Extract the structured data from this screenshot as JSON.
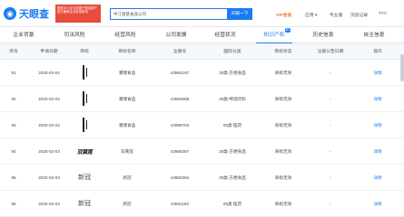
{
  "header": {
    "logo_text": "天眼查",
    "promo_text": "国家中小企业发展子基金旗下 官方备案企业征信机构",
    "search_value": "中汀盘基食品公司",
    "search_button": "天眼一下",
    "nav": {
      "vip": "VIP会员",
      "app": "应用 ▾",
      "pro": "专业版",
      "service": "服务▾",
      "more": "浏览记录",
      "user": "TYC"
    }
  },
  "tabs": [
    {
      "label": "企业背景",
      "count": ""
    },
    {
      "label": "司法风险",
      "count": ""
    },
    {
      "label": "经营风险",
      "count": ""
    },
    {
      "label": "公司发展",
      "count": ""
    },
    {
      "label": "经营状况",
      "count": ""
    },
    {
      "label": "知识产权",
      "count": "81"
    },
    {
      "label": "历史信息",
      "count": ""
    },
    {
      "label": "自主信息",
      "count": ""
    }
  ],
  "table": {
    "headers": [
      "序号",
      "申请日期",
      "商标",
      "商标名称",
      "注册号",
      "国际分类",
      "商标状态",
      "注册公告日期",
      "操作"
    ],
    "rows": [
      {
        "idx": "91",
        "date": "2020-02-04",
        "name": "潘瑞食品",
        "reg": "43994167",
        "cls": "30类-方便食品",
        "status": "商标无效",
        "pub": "-",
        "op": "详情"
      },
      {
        "idx": "92",
        "date": "2020-02-04",
        "name": "潘瑞食品",
        "reg": "43993088",
        "cls": "33类-啤酒饮料",
        "status": "商标无效",
        "pub": "-",
        "op": "详情"
      },
      {
        "idx": "93",
        "date": "2020-02-04",
        "name": "潘瑞食品",
        "reg": "43998753",
        "cls": "05类-医药",
        "status": "商标无效",
        "pub": "-",
        "op": "详情"
      },
      {
        "idx": "94",
        "date": "2020-02-03",
        "name": "双黄莲",
        "reg": "43968387",
        "cls": "30类-方便食品",
        "status": "商标无效",
        "pub": "-",
        "op": "详情",
        "mark": "双黄莲"
      },
      {
        "idx": "95",
        "date": "2020-02-03",
        "name": "新冠",
        "reg": "43960384",
        "cls": "30类-方便食品",
        "status": "商标无效",
        "pub": "-",
        "op": "详情",
        "mark": "新冠"
      },
      {
        "idx": "96",
        "date": "2020-02-03",
        "name": "新冠",
        "reg": "43961180",
        "cls": "05类-医药",
        "status": "商标无效",
        "pub": "-",
        "op": "详情",
        "mark": "新冠"
      }
    ]
  },
  "colors": {
    "accent": "#1a7cf2",
    "promo": "#e84c3d",
    "vip": "#e8742f"
  }
}
